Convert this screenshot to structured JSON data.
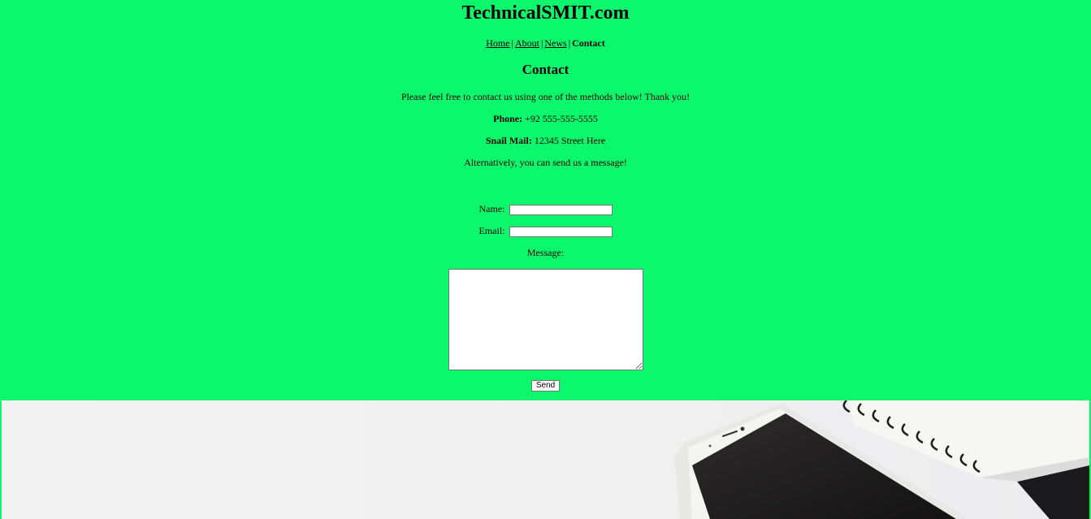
{
  "site": {
    "title": "TechnicalSMIT.com"
  },
  "nav": {
    "home": "Home",
    "about": "About",
    "news": "News",
    "contact": "Contact",
    "separator": "|"
  },
  "page": {
    "title": "Contact",
    "intro": "Please feel free to contact us using one of the methods below! Thank you!",
    "phone_label": "Phone:",
    "phone_value": "+92 555-555-5555",
    "mail_label": "Snail Mail:",
    "mail_value": "12345 Street Here",
    "alt_text": "Alternatively, you can send us a message!"
  },
  "form": {
    "name_label": "Name:",
    "name_value": "",
    "email_label": "Email:",
    "email_value": "",
    "message_label": "Message:",
    "message_value": "",
    "send_label": "Send"
  },
  "colors": {
    "background": "#0cf86c"
  },
  "image": {
    "description_icon": "desk-phone-notebook-photo"
  }
}
